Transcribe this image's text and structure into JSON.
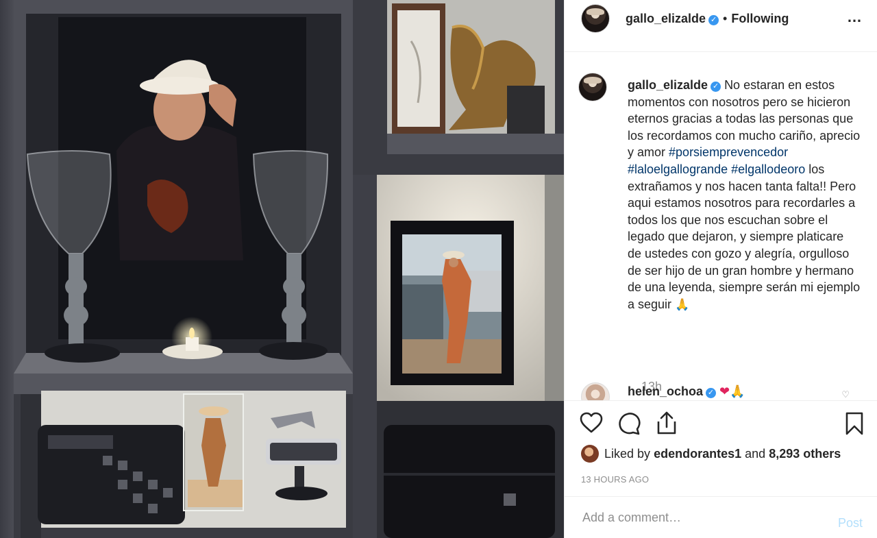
{
  "post": {
    "username": "gallo_elizalde",
    "separator": "•",
    "follow_status": "Following",
    "more_icon": "…"
  },
  "caption": {
    "username": "gallo_elizalde",
    "text_1": "No estaran en estos momentos con nosotros pero se hicieron eternos gracias a todas las personas que los recordamos con mucho cariño, aprecio y amor",
    "hashtag_1": "#porsiemprevencedor",
    "hashtag_2": "#laloelgallogrande",
    "hashtag_3": "#elgallodeoro",
    "text_2": "los extrañamos y nos hacen tanta falta!! Pero aqui estamos nosotros para recordarles a todos los que nos escuchan sobre el legado que dejaron, y siempre platicare de ustedes con gozo y alegría, orgulloso de ser hijo de un gran hombre y hermano de una leyenda, siempre serán mi ejemplo a seguir",
    "emoji": "🙏",
    "time": "13h"
  },
  "comment": {
    "username": "helen_ochoa",
    "emoji_heart": "❤",
    "emoji_pray": "🙏"
  },
  "likes": {
    "prefix": "Liked by",
    "liker": "edendorantes1",
    "and": "and",
    "count": "8,293 others"
  },
  "timestamp": "13 HOURS AGO",
  "comment_box": {
    "placeholder": "Add a comment…",
    "post_label": "Post"
  },
  "colors": {
    "link": "#003569",
    "verified": "#3897f0",
    "post_disabled": "#b2dffc",
    "muted": "#8e8e8e"
  }
}
